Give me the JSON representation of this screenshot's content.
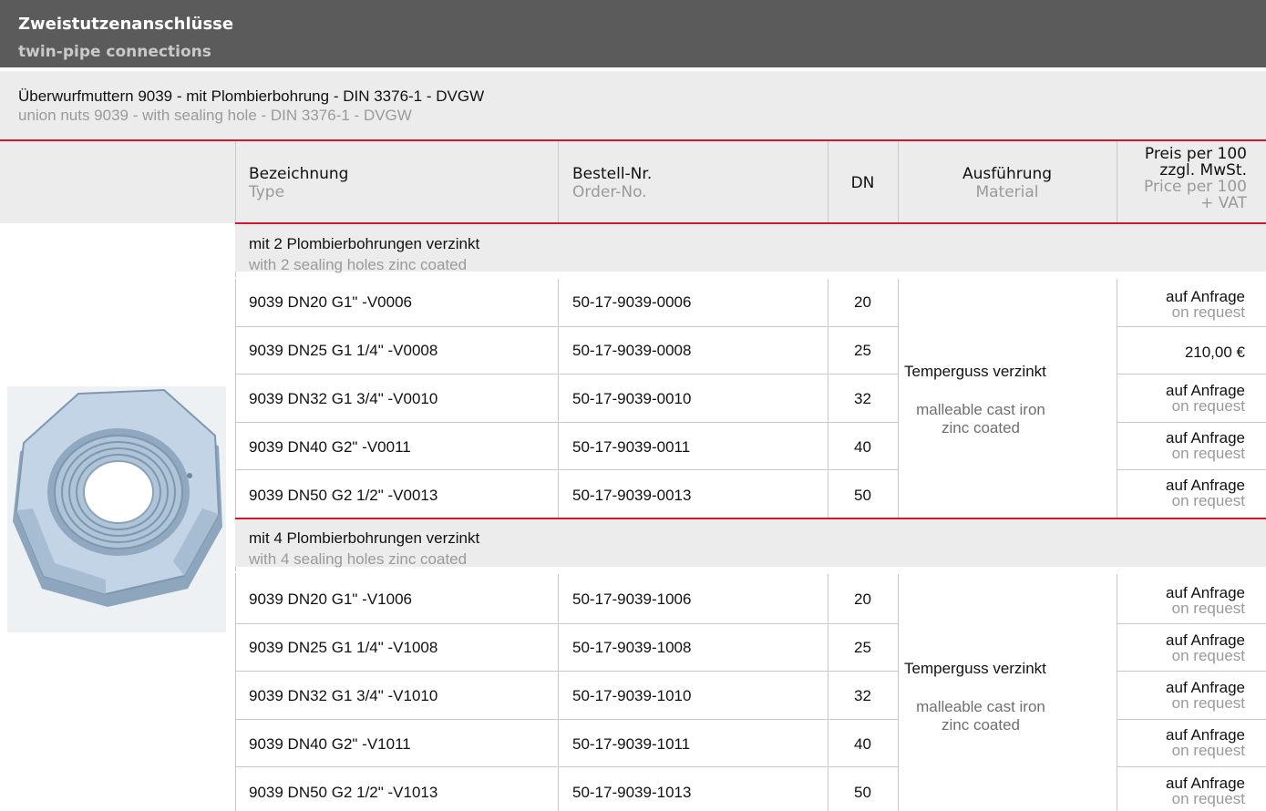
{
  "header": {
    "title": "Zweistutzenanschlüsse",
    "subtitle": "twin-pipe connections"
  },
  "product": {
    "title_de": "Überwurfmuttern 9039 - mit Plombierbohrung - DIN 3376-1 - DVGW",
    "title_en": "union nuts 9039 - with sealing hole - DIN 3376-1 - DVGW",
    "image_icon": "union-nut-photo"
  },
  "columns": {
    "type_de": "Bezeichnung",
    "type_en": "Type",
    "order_de": "Bestell-Nr.",
    "order_en": "Order-No.",
    "dn": "DN",
    "material_de": "Ausführung",
    "material_en": "Material",
    "price_de_1": "Preis per 100",
    "price_de_2": "zzgl. MwSt.",
    "price_en_1": "Price per 100",
    "price_en_2": "+ VAT"
  },
  "groups": [
    {
      "title_de": "mit 2 Plombierbohrungen verzinkt",
      "title_en": "with 2 sealing holes zinc coated",
      "material_de": "Temperguss verzinkt",
      "material_en_1": "malleable cast iron",
      "material_en_2": "zinc coated",
      "rows": [
        {
          "type": "9039 DN20 G1\" -V0006",
          "order": "50-17-9039-0006",
          "dn": "20",
          "price_de": "auf Anfrage",
          "price_en": "on request"
        },
        {
          "type": "9039 DN25 G1 1/4\" -V0008",
          "order": "50-17-9039-0008",
          "dn": "25",
          "price_de": "210,00 €",
          "price_en": ""
        },
        {
          "type": "9039 DN32 G1 3/4\" -V0010",
          "order": "50-17-9039-0010",
          "dn": "32",
          "price_de": "auf Anfrage",
          "price_en": "on request"
        },
        {
          "type": "9039 DN40 G2\" -V0011",
          "order": "50-17-9039-0011",
          "dn": "40",
          "price_de": "auf Anfrage",
          "price_en": "on request"
        },
        {
          "type": "9039 DN50 G2 1/2\" -V0013",
          "order": "50-17-9039-0013",
          "dn": "50",
          "price_de": "auf Anfrage",
          "price_en": "on request"
        }
      ]
    },
    {
      "title_de": "mit 4 Plombierbohrungen verzinkt",
      "title_en": "with 4 sealing holes zinc coated",
      "material_de": "Temperguss verzinkt",
      "material_en_1": "malleable cast iron",
      "material_en_2": "zinc coated",
      "rows": [
        {
          "type": "9039 DN20 G1\" -V1006",
          "order": "50-17-9039-1006",
          "dn": "20",
          "price_de": "auf Anfrage",
          "price_en": "on request"
        },
        {
          "type": "9039 DN25 G1 1/4\" -V1008",
          "order": "50-17-9039-1008",
          "dn": "25",
          "price_de": "auf Anfrage",
          "price_en": "on request"
        },
        {
          "type": "9039 DN32 G1 3/4\" -V1010",
          "order": "50-17-9039-1010",
          "dn": "32",
          "price_de": "auf Anfrage",
          "price_en": "on request"
        },
        {
          "type": "9039 DN40 G2\" -V1011",
          "order": "50-17-9039-1011",
          "dn": "40",
          "price_de": "auf Anfrage",
          "price_en": "on request"
        },
        {
          "type": "9039 DN50 G2 1/2\" -V1013",
          "order": "50-17-9039-1013",
          "dn": "50",
          "price_de": "auf Anfrage",
          "price_en": "on request"
        }
      ]
    }
  ]
}
